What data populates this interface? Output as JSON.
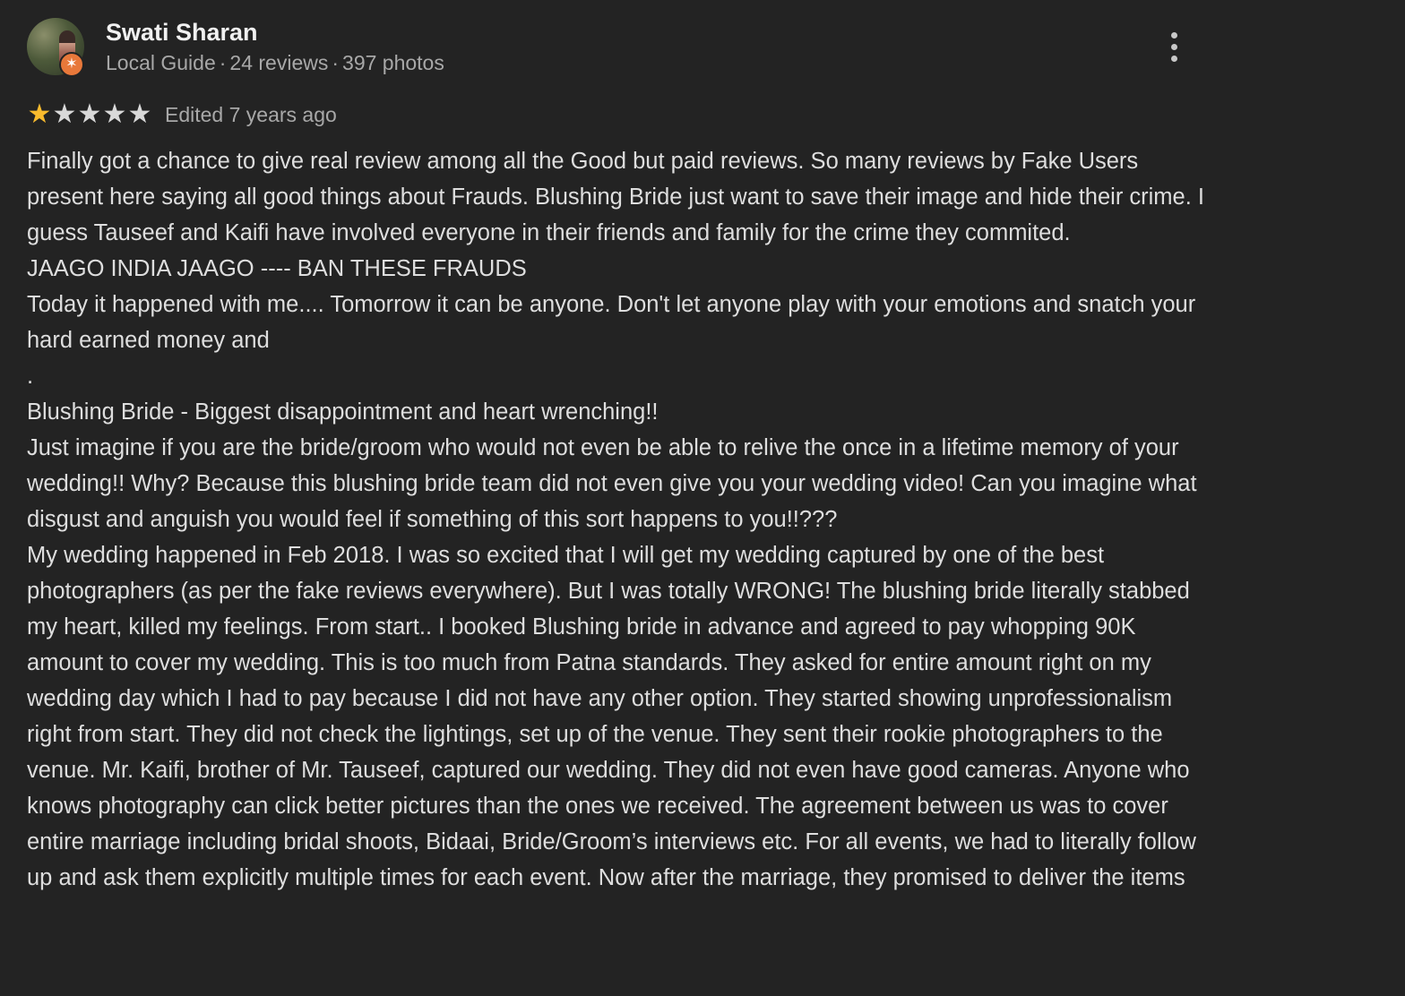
{
  "reviewer": {
    "name": "Swati Sharan",
    "role": "Local Guide",
    "reviews": "24 reviews",
    "photos": "397 photos",
    "separator": "·",
    "badge_icon": "local-guide-star-icon",
    "badge_color": "#e8783a"
  },
  "menu": {
    "icon": "more-vertical-icon"
  },
  "rating": {
    "value": 1,
    "max": 5,
    "filled_color": "#f9bb2d",
    "empty_color": "#d9d9d9",
    "edited": "Edited 7 years ago"
  },
  "review": {
    "paragraphs": [
      "Finally got a chance to give real review among all the Good but paid reviews. So many reviews by Fake Users present here saying all good things about Frauds. Blushing Bride just want to save their image and hide their crime. I guess Tauseef and Kaifi have involved everyone in their friends and family for the crime they commited.",
      "JAAGO INDIA JAAGO ---- BAN THESE FRAUDS",
      "Today it happened with me.... Tomorrow it can be anyone. Don't let anyone play with your emotions and snatch your hard earned money and",
      ".",
      "Blushing Bride - Biggest disappointment and heart wrenching!!",
      "Just imagine if you are the bride/groom who would not even be able to relive the once in a lifetime memory of your wedding!! Why? Because this blushing bride team did not even give you your wedding video! Can you imagine what disgust and anguish you would feel if something of this sort happens to you!!???",
      "My wedding happened in Feb 2018. I was so excited that I will get my wedding captured by one of the best photographers (as per the fake reviews everywhere). But I was totally WRONG! The blushing bride literally stabbed my heart, killed my feelings. From start.. I booked Blushing bride in advance and agreed to pay whopping 90K amount to cover my wedding. This is too much from Patna standards. They asked for entire amount right on my wedding day which I had to pay because I did not have any other option. They started showing unprofessionalism right from start. They did not check the lightings, set up of the venue. They sent their rookie photographers to the venue. Mr. Kaifi, brother of Mr. Tauseef, captured our wedding. They did not even have good cameras. Anyone who knows photography can click better pictures than the ones we received. The agreement between us was to cover entire marriage including bridal shoots, Bidaai, Bride/Groom’s interviews etc. For all events, we had to literally follow up and ask them explicitly multiple times for each event. Now after the marriage, they promised to deliver the items"
    ]
  }
}
